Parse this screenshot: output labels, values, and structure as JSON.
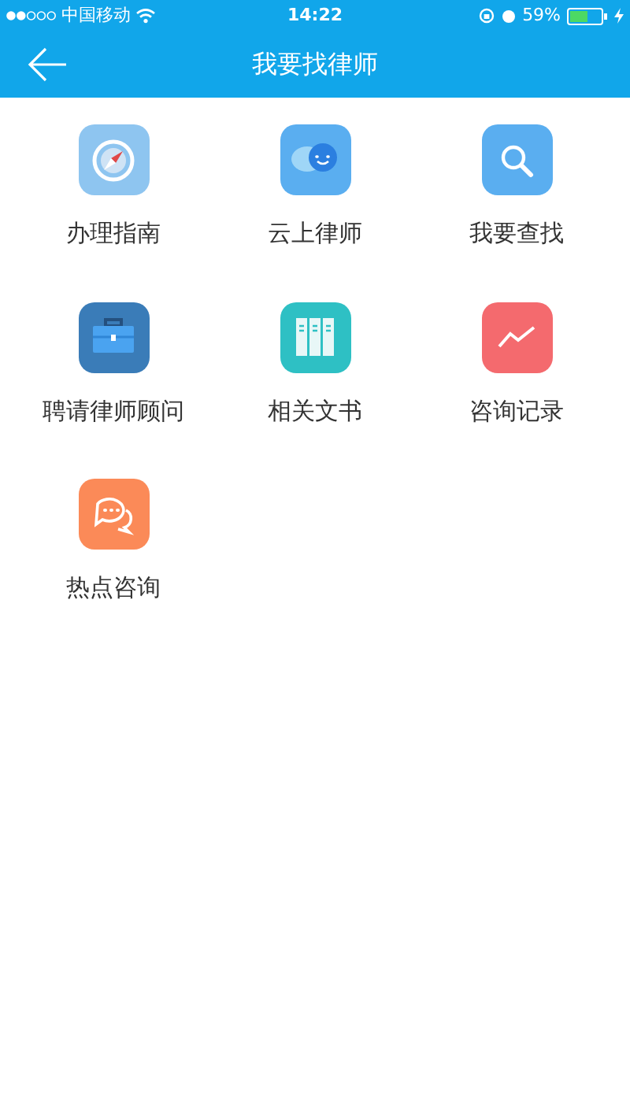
{
  "status_bar": {
    "carrier": "中国移动",
    "time": "14:22",
    "battery": "59%"
  },
  "nav": {
    "title": "我要找律师"
  },
  "items": [
    {
      "label": "办理指南",
      "kind": "compass",
      "color": "#8ec5f0"
    },
    {
      "label": "云上律师",
      "kind": "chat",
      "color": "#5aaef0"
    },
    {
      "label": "我要查找",
      "kind": "search",
      "color": "#5aaef0"
    },
    {
      "label": "聘请律师顾问",
      "kind": "briefcase",
      "color": "#3a7cb8"
    },
    {
      "label": "相关文书",
      "kind": "binders",
      "color": "#2ec0c4"
    },
    {
      "label": "咨询记录",
      "kind": "trend",
      "color": "#f46a6e"
    },
    {
      "label": "热点咨询",
      "kind": "bubbles",
      "color": "#fb8a58"
    }
  ]
}
